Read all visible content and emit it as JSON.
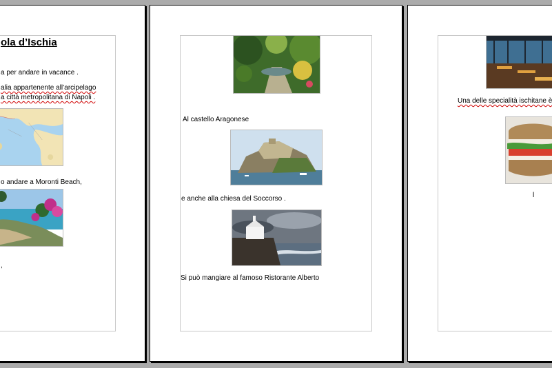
{
  "page1": {
    "title": "ola d’Ischia",
    "line1": "a per andare in vacance .",
    "line2": "alia appartenente all’arcipelago",
    "line3": "a città metropolitana di Napoli .",
    "line4": "o andare a Moronti Beach,",
    "line5": ","
  },
  "page2": {
    "caption1": "Al castello Aragonese",
    "caption2": "e anche alla chiesa del Soccorso .",
    "caption3": "Si può mangiare al famoso Ristorante Alberto"
  },
  "page3": {
    "caption1": "Una delle specialità ischitane è",
    "caption2": "l"
  }
}
